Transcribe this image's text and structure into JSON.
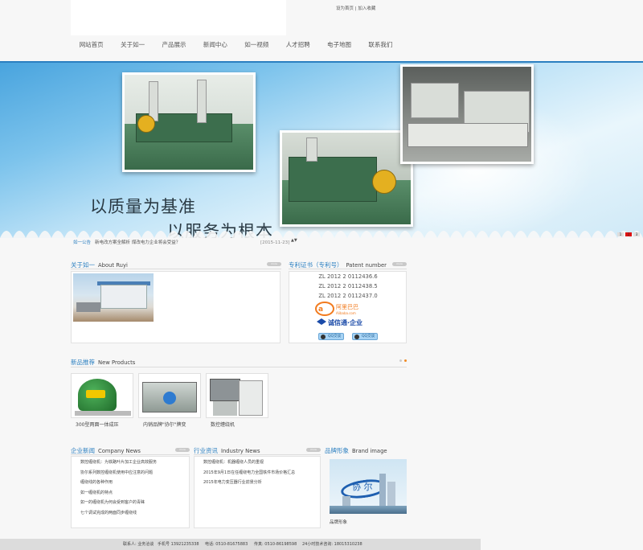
{
  "header": {
    "toplinks": "设为首页 | 加入收藏",
    "nav": [
      {
        "label": "网站首页"
      },
      {
        "label": "关于如一"
      },
      {
        "label": "产品展示"
      },
      {
        "label": "新闻中心"
      },
      {
        "label": "如一视频"
      },
      {
        "label": "人才招聘"
      },
      {
        "label": "电子地图"
      },
      {
        "label": "联系我们"
      }
    ]
  },
  "banner": {
    "slogan_line1": "以质量为基准",
    "slogan_line2": "以服务为根本",
    "dots": [
      "1",
      "2",
      "3"
    ],
    "active_dot": 1
  },
  "notice": {
    "label": "如一公告",
    "text": "新电改方案全解析 煤改电力企业将会受益？",
    "date": "[2015-11-23]",
    "arrows": "▲▼"
  },
  "about": {
    "title_cn": "关于如一",
    "title_en": "About Ruyi",
    "more": "more"
  },
  "patent": {
    "title_cn": "专利证书（专利号）",
    "title_en": "Patent number",
    "more": "more",
    "numbers": [
      "ZL 2012 2 0112436.6",
      "ZL 2012 2 0112438.5",
      "ZL 2012 2 0112437.0"
    ],
    "alibaba_brand": "阿里巴巴",
    "alibaba_site": "Alibaba.com",
    "chengxintong": "诚信通·企业",
    "qq_buttons": [
      "QQ交谈",
      "QQ交谈"
    ]
  },
  "products": {
    "title_cn": "新品推荐",
    "title_en": "New Products",
    "items": [
      {
        "label": "300型两面一体成压"
      },
      {
        "label": "内销品牌\"协尔\"牌变"
      },
      {
        "label": "数控缠绕机"
      }
    ]
  },
  "company_news": {
    "title_cn": "企业新闻",
    "title_en": "Company News",
    "more": "more",
    "items": [
      "数控缠绕机：为铁路叶片加工企业高效服务",
      "协尔系列数控缠绕机使用中应注意的问题",
      "缠绕线的各种作用",
      "如一缠绕机的特点",
      "如一的缠绕机为何会受到客户的青睐",
      "七个调试完成的两面同步缠绕线"
    ]
  },
  "industry_news": {
    "title_cn": "行业资讯",
    "title_en": "Industry News",
    "more": "more",
    "items": [
      "数控缠绕机：机器缠绕人员的重视",
      "2015年9月1日在任缠绕电力全国铁件市场价格汇总",
      "2015年电力变压器行业前景分析"
    ]
  },
  "brand": {
    "title_cn": "品牌形象",
    "title_en": "Brand image",
    "label": "品牌形象",
    "logo_text": "协 尔"
  },
  "footer": {
    "contact": "联系人: 业务洽谈",
    "mobile": "手机号 13921235338",
    "phone": "电话: 0510-81675883",
    "fax": "传真: 0510-86198598",
    "hotline": "24小时技术咨询: 18015310238"
  },
  "colors": {
    "accent": "#2b7fc0",
    "notice_active": "#d11",
    "pager_active": "#f08a24"
  }
}
